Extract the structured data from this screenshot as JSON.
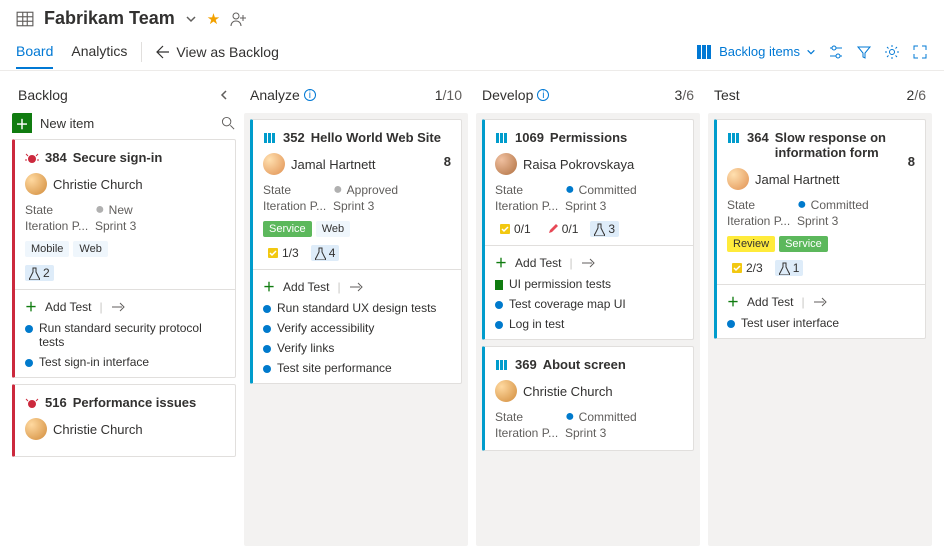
{
  "header": {
    "team_name": "Fabrikam Team"
  },
  "tabs": {
    "board": "Board",
    "analytics": "Analytics",
    "view_as_backlog": "View as Backlog",
    "backlog_items": "Backlog items"
  },
  "columns": {
    "backlog": {
      "title": "Backlog",
      "new_item": "New item"
    },
    "analyze": {
      "title": "Analyze",
      "done": "1",
      "cap": "/10"
    },
    "develop": {
      "title": "Develop",
      "done": "3",
      "cap": "/6"
    },
    "test": {
      "title": "Test",
      "done": "2",
      "cap": "/6"
    }
  },
  "labels": {
    "state": "State",
    "iteration": "Iteration P...",
    "add_test": "Add Test"
  },
  "cards": {
    "c384": {
      "id": "384",
      "title": "Secure sign-in",
      "assignee": "Christie Church",
      "state": "New",
      "iteration": "Sprint 3",
      "tags": {
        "t1": "Mobile",
        "t2": "Web"
      },
      "flask": "2",
      "subs": {
        "s1": "Run standard security protocol tests",
        "s2": "Test sign-in interface"
      }
    },
    "c516": {
      "id": "516",
      "title": "Performance issues",
      "assignee": "Christie Church"
    },
    "c352": {
      "id": "352",
      "title": "Hello World Web Site",
      "assignee": "Jamal Hartnett",
      "sp": "8",
      "state": "Approved",
      "iteration": "Sprint 3",
      "tags": {
        "t1": "Service",
        "t2": "Web"
      },
      "chk": "1/3",
      "flask": "4",
      "subs": {
        "s1": "Run standard UX design tests",
        "s2": "Verify accessibility",
        "s3": "Verify links",
        "s4": "Test site performance"
      }
    },
    "c1069": {
      "id": "1069",
      "title": "Permissions",
      "assignee": "Raisa Pokrovskaya",
      "state": "Committed",
      "iteration": "Sprint 3",
      "chk": "0/1",
      "pen": "0/1",
      "flask": "3",
      "subs": {
        "s1": "UI permission tests",
        "s2": "Test coverage map UI",
        "s3": "Log in test"
      }
    },
    "c369": {
      "id": "369",
      "title": "About screen",
      "assignee": "Christie Church",
      "state": "Committed",
      "iteration": "Sprint 3"
    },
    "c364": {
      "id": "364",
      "title": "Slow response on information form",
      "assignee": "Jamal Hartnett",
      "sp": "8",
      "state": "Committed",
      "iteration": "Sprint 3",
      "tags": {
        "t1": "Review",
        "t2": "Service"
      },
      "chk": "2/3",
      "flask": "1",
      "subs": {
        "s1": "Test user interface"
      }
    }
  }
}
